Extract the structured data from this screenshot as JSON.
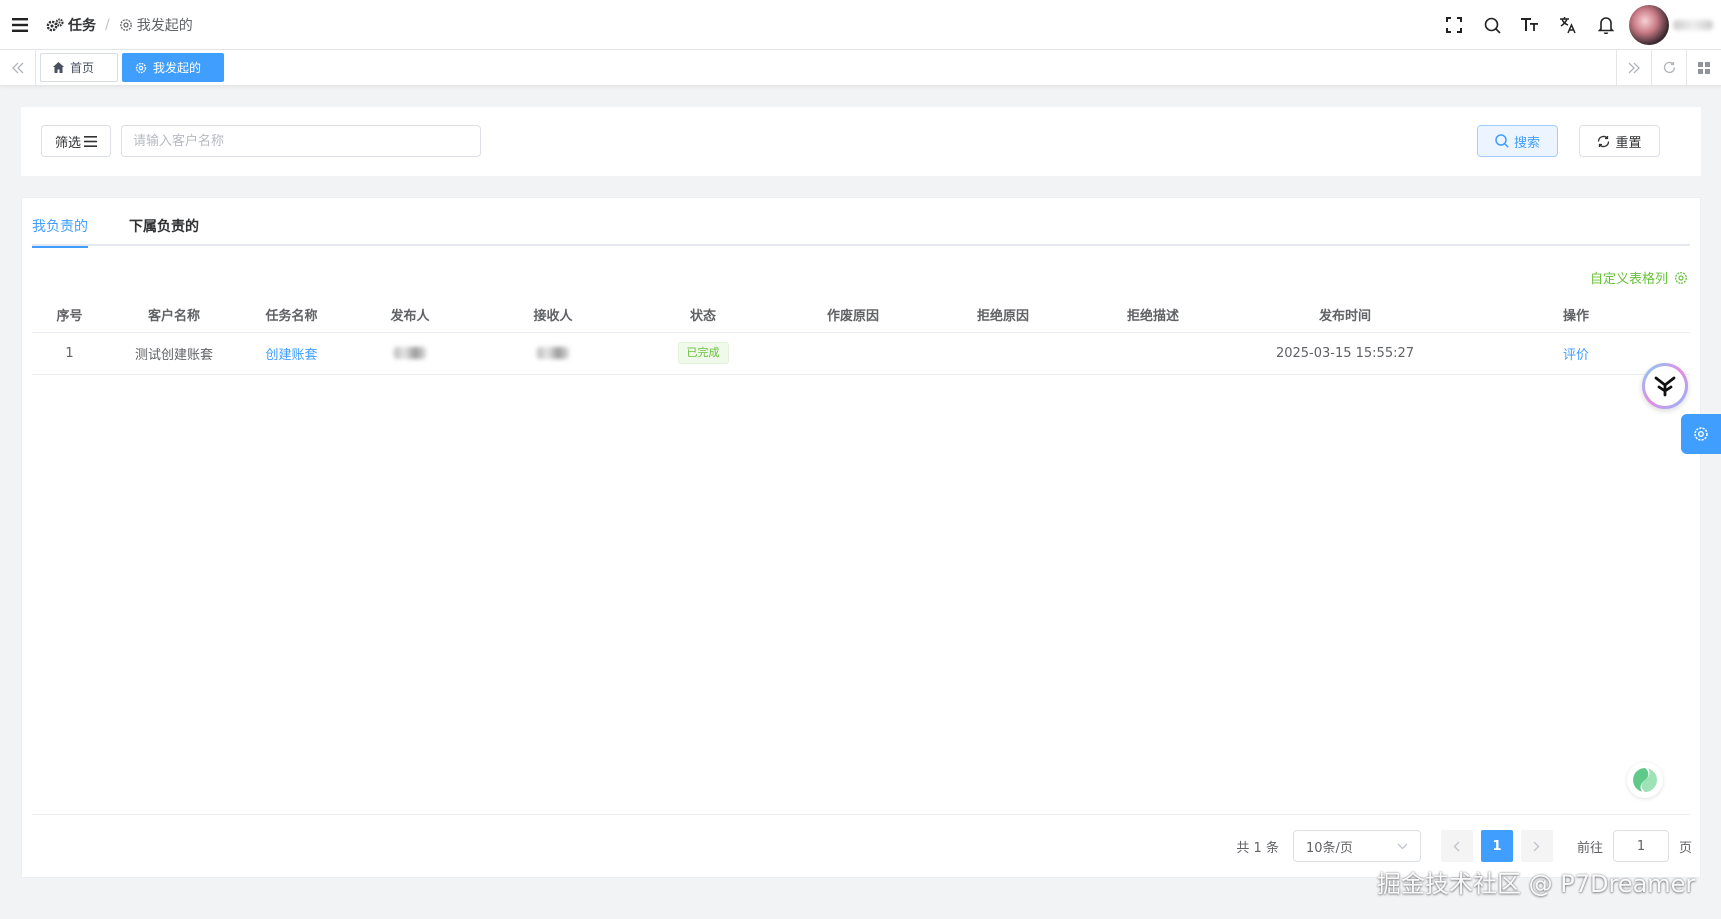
{
  "header": {
    "breadcrumb": [
      {
        "label": "任务",
        "icon": "gears-icon"
      },
      {
        "label": "我发起的",
        "icon": "gear-icon"
      }
    ],
    "separator": "/",
    "icons": [
      "fullscreen-icon",
      "search-icon",
      "font-size-icon",
      "translate-icon",
      "bell-icon"
    ]
  },
  "tags": {
    "home": "首页",
    "active": "我发起的"
  },
  "search": {
    "filter_label": "筛选",
    "placeholder": "请输入客户名称",
    "value": "",
    "search_label": "搜索",
    "reset_label": "重置"
  },
  "tabs": [
    {
      "label": "我负责的",
      "active": true
    },
    {
      "label": "下属负责的",
      "active": false
    }
  ],
  "custom_columns_label": "自定义表格列",
  "table": {
    "columns": [
      "序号",
      "客户名称",
      "任务名称",
      "发布人",
      "接收人",
      "状态",
      "作废原因",
      "拒绝原因",
      "拒绝描述",
      "发布时间",
      "操作"
    ],
    "rows": [
      {
        "index": "1",
        "customer": "测试创建账套",
        "task": "创建账套",
        "publisher": "",
        "receiver": "",
        "status": "已完成",
        "void_reason": "",
        "reject_reason": "",
        "reject_desc": "",
        "publish_time": "2025-03-15 15:55:27",
        "action": "评价"
      }
    ]
  },
  "pagination": {
    "total": "共 1 条",
    "page_size": "10条/页",
    "current_page": "1",
    "goto_label": "前往",
    "goto_value": "1",
    "page_suffix": "页"
  },
  "watermark": "掘金技术社区 @ P7Dreamer",
  "colors": {
    "primary": "#409eff",
    "success": "#67c23a",
    "page_bg": "#f2f3f5"
  }
}
